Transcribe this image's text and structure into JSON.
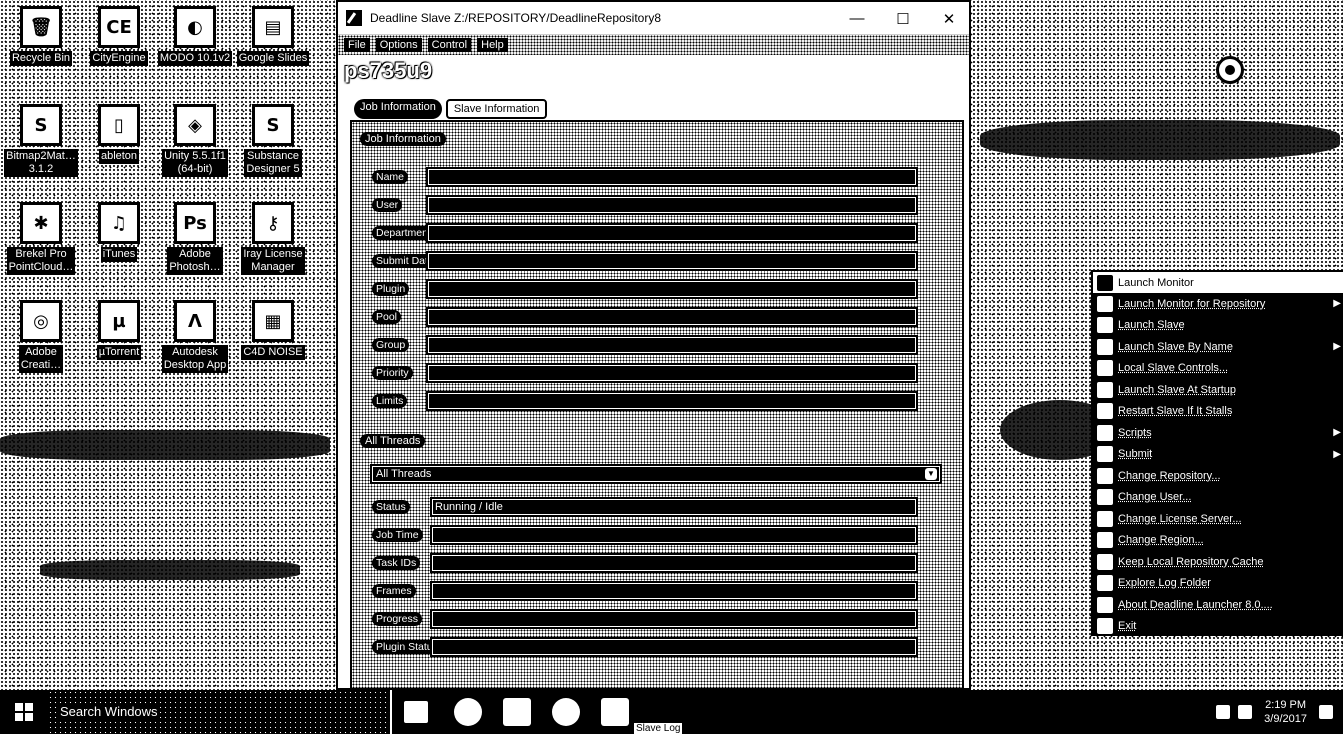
{
  "desktop": {
    "icons": [
      {
        "label": "Recycle Bin",
        "glyph": "🗑",
        "name": "recycle-bin"
      },
      {
        "label": "CityEngine",
        "glyph": "CE",
        "name": "cityengine"
      },
      {
        "label": "MODO 10.1v2",
        "glyph": "◐",
        "name": "modo"
      },
      {
        "label": "Google Slides",
        "glyph": "▤",
        "name": "google-slides"
      },
      {
        "label": "Bitmap2Mat…\n3.1.2",
        "glyph": "S",
        "name": "bitmap2material"
      },
      {
        "label": "ableton",
        "glyph": "▯",
        "name": "ableton"
      },
      {
        "label": "Unity 5.5.1f1\n(64-bit)",
        "glyph": "◈",
        "name": "unity"
      },
      {
        "label": "Substance\nDesigner 5",
        "glyph": "S",
        "name": "substance-designer"
      },
      {
        "label": "Brekel Pro\nPointCloud…",
        "glyph": "✱",
        "name": "brekel"
      },
      {
        "label": "iTunes",
        "glyph": "♫",
        "name": "itunes"
      },
      {
        "label": "Adobe\nPhotosh…",
        "glyph": "Ps",
        "name": "photoshop"
      },
      {
        "label": "Iray License\nManager",
        "glyph": "⚷",
        "name": "iray-license"
      },
      {
        "label": "Adobe\nCreati…",
        "glyph": "◎",
        "name": "adobe-creative"
      },
      {
        "label": "µTorrent",
        "glyph": "µ",
        "name": "utorrent"
      },
      {
        "label": "Autodesk\nDesktop App",
        "glyph": "Λ",
        "name": "autodesk"
      },
      {
        "label": "C4D NOISE",
        "glyph": "▦",
        "name": "c4d-noise"
      }
    ]
  },
  "window": {
    "title": "Deadline Slave   Z:/REPOSITORY/DeadlineRepository8",
    "menu": [
      "File",
      "Options",
      "Control",
      "Help"
    ],
    "hostname": "ps735u9",
    "tabs": [
      "Job Information",
      "Slave Information"
    ],
    "job_section": "Job Information",
    "job_fields": [
      {
        "label": "Name",
        "value": ""
      },
      {
        "label": "User",
        "value": ""
      },
      {
        "label": "Department",
        "value": ""
      },
      {
        "label": "Submit Date",
        "value": ""
      },
      {
        "label": "Plugin",
        "value": ""
      },
      {
        "label": "Pool",
        "value": ""
      },
      {
        "label": "Group",
        "value": ""
      },
      {
        "label": "Priority",
        "value": ""
      },
      {
        "label": "Limits",
        "value": ""
      }
    ],
    "threads_section": "All Threads",
    "threads_select": "All Threads",
    "thread_fields": [
      {
        "label": "Status",
        "value": "Running / Idle"
      },
      {
        "label": "Job Time",
        "value": ""
      },
      {
        "label": "Task IDs",
        "value": ""
      },
      {
        "label": "Frames",
        "value": ""
      },
      {
        "label": "Progress",
        "value": ""
      },
      {
        "label": "Plugin Status",
        "value": ""
      }
    ]
  },
  "context_menu": {
    "header": "Launch Monitor",
    "items": [
      {
        "label": "Launch Monitor for Repository",
        "submenu": true
      },
      {
        "label": "Launch Slave",
        "submenu": false
      },
      {
        "label": "Launch Slave By Name",
        "submenu": true
      },
      {
        "label": "Local Slave Controls...",
        "submenu": false
      },
      {
        "label": "Launch Slave At Startup",
        "submenu": false
      },
      {
        "label": "Restart Slave If It Stalls",
        "submenu": false
      },
      {
        "label": "Scripts",
        "submenu": true
      },
      {
        "label": "Submit",
        "submenu": true
      },
      {
        "label": "Change Repository...",
        "submenu": false
      },
      {
        "label": "Change User...",
        "submenu": false
      },
      {
        "label": "Change License Server...",
        "submenu": false
      },
      {
        "label": "Change Region...",
        "submenu": false
      },
      {
        "label": "Keep Local Repository Cache",
        "submenu": false
      },
      {
        "label": "Explore Log Folder",
        "submenu": false
      },
      {
        "label": "About Deadline Launcher 8.0....",
        "submenu": false
      },
      {
        "label": "Exit",
        "submenu": false
      }
    ]
  },
  "taskbar": {
    "search_placeholder": "Search Windows",
    "time": "2:19 PM",
    "date": "3/9/2017",
    "tooltip": "Slave Log"
  }
}
